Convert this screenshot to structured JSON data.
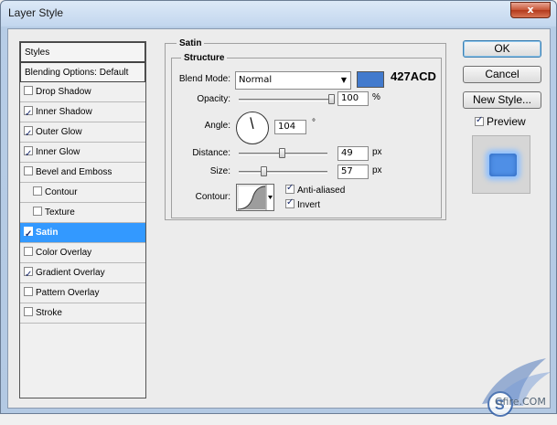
{
  "window": {
    "title": "Layer Style",
    "close_label": "x"
  },
  "sidebar": {
    "items": [
      {
        "label": "Styles",
        "checkbox": false,
        "checked": false,
        "header": true
      },
      {
        "label": "Blending Options: Default",
        "checkbox": false,
        "checked": false,
        "header": true
      },
      {
        "label": "Drop Shadow",
        "checkbox": true,
        "checked": false
      },
      {
        "label": "Inner Shadow",
        "checkbox": true,
        "checked": true
      },
      {
        "label": "Outer Glow",
        "checkbox": true,
        "checked": true
      },
      {
        "label": "Inner Glow",
        "checkbox": true,
        "checked": true
      },
      {
        "label": "Bevel and Emboss",
        "checkbox": true,
        "checked": false
      },
      {
        "label": "Contour",
        "checkbox": true,
        "checked": false,
        "indent": true
      },
      {
        "label": "Texture",
        "checkbox": true,
        "checked": false,
        "indent": true
      },
      {
        "label": "Satin",
        "checkbox": true,
        "checked": true,
        "selected": true
      },
      {
        "label": "Color Overlay",
        "checkbox": true,
        "checked": false
      },
      {
        "label": "Gradient Overlay",
        "checkbox": true,
        "checked": true
      },
      {
        "label": "Pattern Overlay",
        "checkbox": true,
        "checked": false
      },
      {
        "label": "Stroke",
        "checkbox": true,
        "checked": false
      }
    ]
  },
  "satin": {
    "title": "Satin",
    "structure_title": "Structure",
    "blend_mode_label": "Blend Mode:",
    "blend_mode_value": "Normal",
    "color_hex": "427ACD",
    "color": "#427acd",
    "opacity_label": "Opacity:",
    "opacity_value": "100",
    "opacity_unit": "%",
    "opacity_fraction": 1.0,
    "angle_label": "Angle:",
    "angle_value": "104",
    "angle_unit": "°",
    "distance_label": "Distance:",
    "distance_value": "49",
    "distance_unit": "px",
    "distance_fraction": 0.49,
    "size_label": "Size:",
    "size_value": "57",
    "size_unit": "px",
    "size_fraction": 0.29,
    "contour_label": "Contour:",
    "anti_aliased_label": "Anti-aliased",
    "anti_aliased_checked": true,
    "invert_label": "Invert",
    "invert_checked": true
  },
  "buttons": {
    "ok": "OK",
    "cancel": "Cancel",
    "new_style": "New Style...",
    "preview_label": "Preview",
    "preview_checked": true
  },
  "watermark": {
    "text": "Gfire.COM"
  }
}
